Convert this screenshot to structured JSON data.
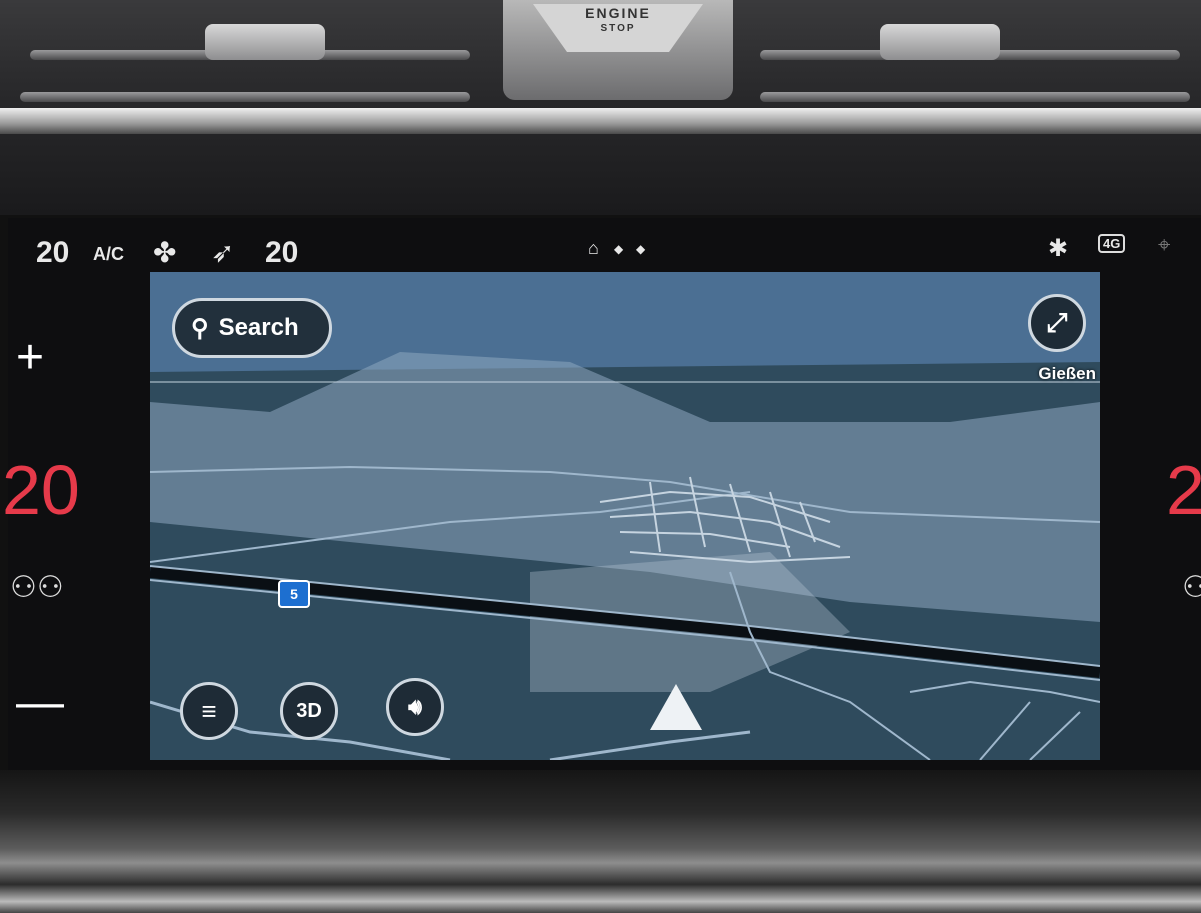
{
  "dashboard": {
    "engine_button_line1": "ENGINE",
    "engine_button_line2": "STOP"
  },
  "status_bar": {
    "left_temp": "20",
    "ac_label": "A/C",
    "fan_icon": "fan-icon",
    "airflow_icon": "airflow-icon",
    "right_temp": "20",
    "home_icon": "home-icon",
    "bluetooth_icon": "bluetooth-icon",
    "network_badge": "4G",
    "location_icon": "location-icon"
  },
  "side_controls": {
    "left_plus": "+",
    "left_minus": "—",
    "left_zone_temp": "20",
    "right_zone_temp": "2"
  },
  "map": {
    "search_label": "Search",
    "place_label": "Gießen",
    "route_shield": "5",
    "view_mode_label": "3D",
    "colors": {
      "sky": "#4b6f93",
      "land": "#2e4a5c",
      "roads": "#9fb7cc"
    }
  }
}
